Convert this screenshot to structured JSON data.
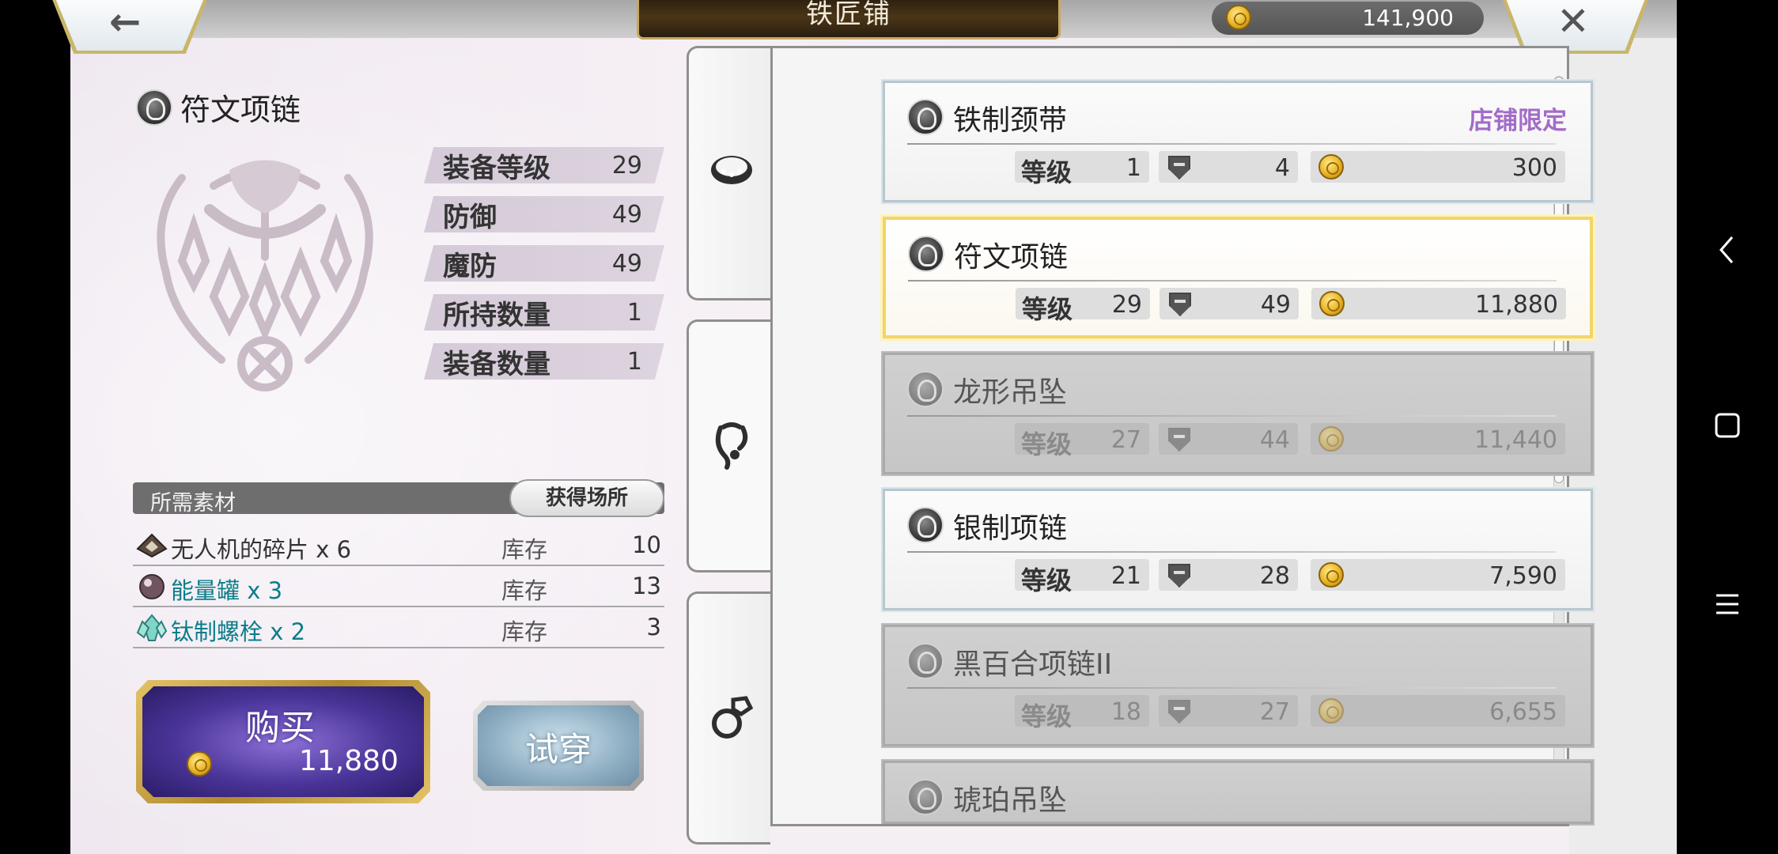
{
  "header": {
    "title": "铁匠铺",
    "coins": "141,900"
  },
  "item": {
    "name": "符文项链",
    "stats": [
      {
        "label": "装备等级",
        "value": "29"
      },
      {
        "label": "防御",
        "value": "49"
      },
      {
        "label": "魔防",
        "value": "49"
      },
      {
        "label": "所持数量",
        "value": "1"
      },
      {
        "label": "装备数量",
        "value": "1"
      }
    ]
  },
  "materials": {
    "header": "所需素材",
    "location_button": "获得场所",
    "stock_label": "库存",
    "rows": [
      {
        "name": "无人机的碎片 x 6",
        "stock": "10"
      },
      {
        "name": "能量罐 x 3",
        "stock": "13"
      },
      {
        "name": "钛制螺栓 x 2",
        "stock": "3"
      }
    ]
  },
  "actions": {
    "buy_label": "购买",
    "buy_price": "11,880",
    "try_label": "试穿"
  },
  "list": {
    "level_label": "等级",
    "items": [
      {
        "name": "铁制颈带",
        "tag": "店铺限定",
        "level": "1",
        "defense": "4",
        "price": "300",
        "state": "normal"
      },
      {
        "name": "符文项链",
        "tag": "",
        "level": "29",
        "defense": "49",
        "price": "11,880",
        "state": "selected"
      },
      {
        "name": "龙形吊坠",
        "tag": "",
        "level": "27",
        "defense": "44",
        "price": "11,440",
        "state": "disabled"
      },
      {
        "name": "银制项链",
        "tag": "",
        "level": "21",
        "defense": "28",
        "price": "7,590",
        "state": "normal"
      },
      {
        "name": "黑百合项链II",
        "tag": "",
        "level": "18",
        "defense": "27",
        "price": "6,655",
        "state": "disabled"
      },
      {
        "name": "琥珀吊坠",
        "tag": "",
        "level": "",
        "defense": "",
        "price": "",
        "state": "disabled"
      }
    ]
  },
  "colors": {
    "shop_limited": "#a26cc8",
    "material_teal": "#0d7d8a",
    "buy_purple": "#4a3498",
    "selected_gold": "#f1d46c"
  }
}
